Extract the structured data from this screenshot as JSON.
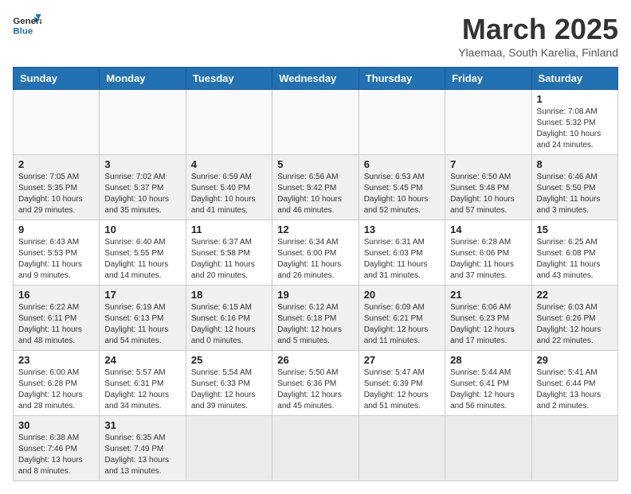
{
  "header": {
    "logo_general": "General",
    "logo_blue": "Blue",
    "month_title": "March 2025",
    "subtitle": "Ylaemaa, South Karelia, Finland"
  },
  "weekdays": [
    "Sunday",
    "Monday",
    "Tuesday",
    "Wednesday",
    "Thursday",
    "Friday",
    "Saturday"
  ],
  "weeks": [
    [
      {
        "day": "",
        "info": ""
      },
      {
        "day": "",
        "info": ""
      },
      {
        "day": "",
        "info": ""
      },
      {
        "day": "",
        "info": ""
      },
      {
        "day": "",
        "info": ""
      },
      {
        "day": "",
        "info": ""
      },
      {
        "day": "1",
        "info": "Sunrise: 7:08 AM\nSunset: 5:32 PM\nDaylight: 10 hours\nand 24 minutes."
      }
    ],
    [
      {
        "day": "2",
        "info": "Sunrise: 7:05 AM\nSunset: 5:35 PM\nDaylight: 10 hours\nand 29 minutes."
      },
      {
        "day": "3",
        "info": "Sunrise: 7:02 AM\nSunset: 5:37 PM\nDaylight: 10 hours\nand 35 minutes."
      },
      {
        "day": "4",
        "info": "Sunrise: 6:59 AM\nSunset: 5:40 PM\nDaylight: 10 hours\nand 41 minutes."
      },
      {
        "day": "5",
        "info": "Sunrise: 6:56 AM\nSunset: 5:42 PM\nDaylight: 10 hours\nand 46 minutes."
      },
      {
        "day": "6",
        "info": "Sunrise: 6:53 AM\nSunset: 5:45 PM\nDaylight: 10 hours\nand 52 minutes."
      },
      {
        "day": "7",
        "info": "Sunrise: 6:50 AM\nSunset: 5:48 PM\nDaylight: 10 hours\nand 57 minutes."
      },
      {
        "day": "8",
        "info": "Sunrise: 6:46 AM\nSunset: 5:50 PM\nDaylight: 11 hours\nand 3 minutes."
      }
    ],
    [
      {
        "day": "9",
        "info": "Sunrise: 6:43 AM\nSunset: 5:53 PM\nDaylight: 11 hours\nand 9 minutes."
      },
      {
        "day": "10",
        "info": "Sunrise: 6:40 AM\nSunset: 5:55 PM\nDaylight: 11 hours\nand 14 minutes."
      },
      {
        "day": "11",
        "info": "Sunrise: 6:37 AM\nSunset: 5:58 PM\nDaylight: 11 hours\nand 20 minutes."
      },
      {
        "day": "12",
        "info": "Sunrise: 6:34 AM\nSunset: 6:00 PM\nDaylight: 11 hours\nand 26 minutes."
      },
      {
        "day": "13",
        "info": "Sunrise: 6:31 AM\nSunset: 6:03 PM\nDaylight: 11 hours\nand 31 minutes."
      },
      {
        "day": "14",
        "info": "Sunrise: 6:28 AM\nSunset: 6:06 PM\nDaylight: 11 hours\nand 37 minutes."
      },
      {
        "day": "15",
        "info": "Sunrise: 6:25 AM\nSunset: 6:08 PM\nDaylight: 11 hours\nand 43 minutes."
      }
    ],
    [
      {
        "day": "16",
        "info": "Sunrise: 6:22 AM\nSunset: 6:11 PM\nDaylight: 11 hours\nand 48 minutes."
      },
      {
        "day": "17",
        "info": "Sunrise: 6:19 AM\nSunset: 6:13 PM\nDaylight: 11 hours\nand 54 minutes."
      },
      {
        "day": "18",
        "info": "Sunrise: 6:15 AM\nSunset: 6:16 PM\nDaylight: 12 hours\nand 0 minutes."
      },
      {
        "day": "19",
        "info": "Sunrise: 6:12 AM\nSunset: 6:18 PM\nDaylight: 12 hours\nand 5 minutes."
      },
      {
        "day": "20",
        "info": "Sunrise: 6:09 AM\nSunset: 6:21 PM\nDaylight: 12 hours\nand 11 minutes."
      },
      {
        "day": "21",
        "info": "Sunrise: 6:06 AM\nSunset: 6:23 PM\nDaylight: 12 hours\nand 17 minutes."
      },
      {
        "day": "22",
        "info": "Sunrise: 6:03 AM\nSunset: 6:26 PM\nDaylight: 12 hours\nand 22 minutes."
      }
    ],
    [
      {
        "day": "23",
        "info": "Sunrise: 6:00 AM\nSunset: 6:28 PM\nDaylight: 12 hours\nand 28 minutes."
      },
      {
        "day": "24",
        "info": "Sunrise: 5:57 AM\nSunset: 6:31 PM\nDaylight: 12 hours\nand 34 minutes."
      },
      {
        "day": "25",
        "info": "Sunrise: 5:54 AM\nSunset: 6:33 PM\nDaylight: 12 hours\nand 39 minutes."
      },
      {
        "day": "26",
        "info": "Sunrise: 5:50 AM\nSunset: 6:36 PM\nDaylight: 12 hours\nand 45 minutes."
      },
      {
        "day": "27",
        "info": "Sunrise: 5:47 AM\nSunset: 6:39 PM\nDaylight: 12 hours\nand 51 minutes."
      },
      {
        "day": "28",
        "info": "Sunrise: 5:44 AM\nSunset: 6:41 PM\nDaylight: 12 hours\nand 56 minutes."
      },
      {
        "day": "29",
        "info": "Sunrise: 5:41 AM\nSunset: 6:44 PM\nDaylight: 13 hours\nand 2 minutes."
      }
    ],
    [
      {
        "day": "30",
        "info": "Sunrise: 6:38 AM\nSunset: 7:46 PM\nDaylight: 13 hours\nand 8 minutes."
      },
      {
        "day": "31",
        "info": "Sunrise: 6:35 AM\nSunset: 7:49 PM\nDaylight: 13 hours\nand 13 minutes."
      },
      {
        "day": "",
        "info": ""
      },
      {
        "day": "",
        "info": ""
      },
      {
        "day": "",
        "info": ""
      },
      {
        "day": "",
        "info": ""
      },
      {
        "day": "",
        "info": ""
      }
    ]
  ]
}
